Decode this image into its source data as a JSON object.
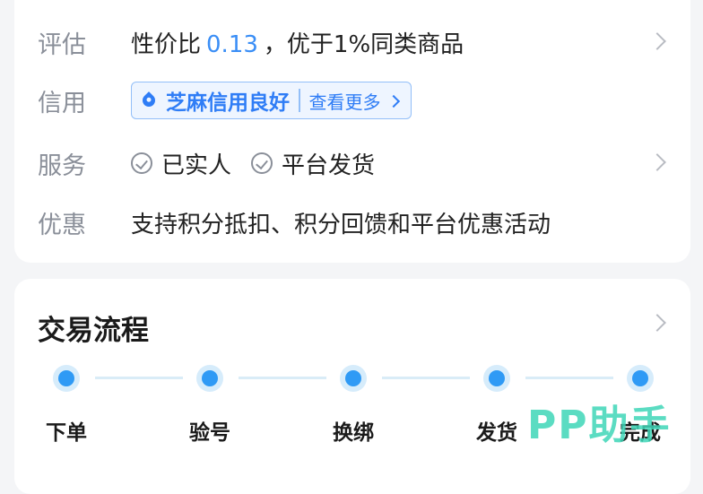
{
  "info": {
    "evaluation": {
      "label": "评估",
      "prefix": "性价比",
      "ratio": "0.13",
      "suffix": "，优于1%同类商品"
    },
    "credit": {
      "label": "信用",
      "badge": "芝麻信用良好",
      "more": "查看更多"
    },
    "service": {
      "label": "服务",
      "items": [
        "已实人",
        "平台发货"
      ]
    },
    "discount": {
      "label": "优惠",
      "text": "支持积分抵扣、积分回馈和平台优惠活动"
    }
  },
  "flow": {
    "title": "交易流程",
    "steps": [
      "下单",
      "验号",
      "换绑",
      "发货",
      "完成"
    ]
  },
  "watermark": "PP助手",
  "colors": {
    "accent": "#3a8ef6",
    "credit_blue": "#2f7df6",
    "step_dot": "#2f9af5",
    "watermark": "#3fd6b8"
  }
}
